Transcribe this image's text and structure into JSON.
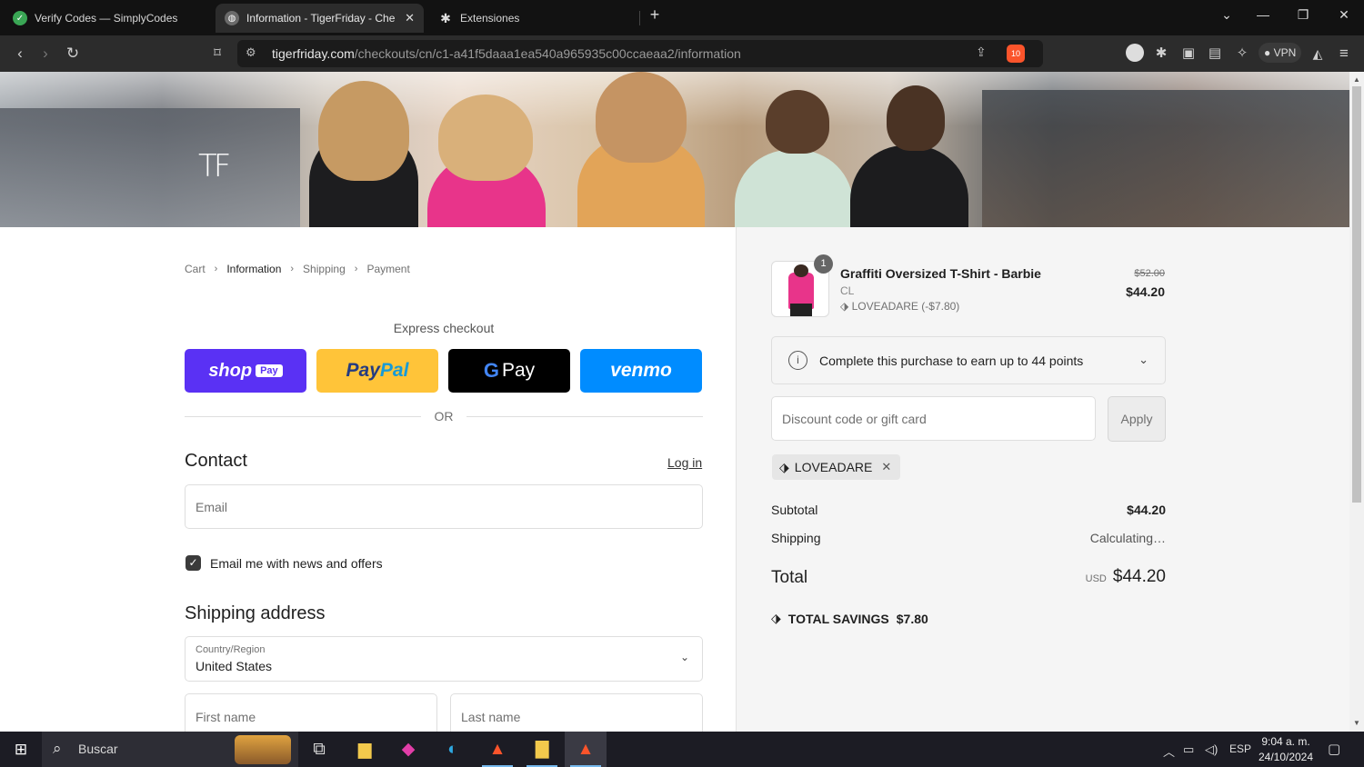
{
  "browser": {
    "tabs": [
      {
        "title": "Verify Codes — SimplyCodes",
        "icon": "simplycodes-icon"
      },
      {
        "title": "Information - TigerFriday - Che",
        "icon": "globe-icon"
      },
      {
        "title": "Extensiones",
        "icon": "puzzle-icon"
      }
    ],
    "url_host": "tigerfriday.com",
    "url_path": "/checkouts/cn/c1-a41f5daaa1ea540a965935c00ccaeaa2/information",
    "brave_badge": "10",
    "vpn_label": "VPN"
  },
  "store": {
    "logo_text": "TF"
  },
  "checkout": {
    "breadcrumb": [
      "Cart",
      "Information",
      "Shipping",
      "Payment"
    ],
    "express_title": "Express checkout",
    "express_buttons": {
      "shop": "shop",
      "shop_pay": "Pay",
      "paypal_a": "Pay",
      "paypal_b": "Pal",
      "gpay": "Pay",
      "venmo": "venmo"
    },
    "or_label": "OR",
    "contact_title": "Contact",
    "login_label": "Log in",
    "email_placeholder": "Email",
    "news_label": "Email me with news and offers",
    "shipping_title": "Shipping address",
    "country_label": "Country/Region",
    "country_value": "United States",
    "first_name_placeholder": "First name",
    "last_name_placeholder": "Last name"
  },
  "summary": {
    "quantity": "1",
    "product_name": "Graffiti Oversized T-Shirt - Barbie",
    "variant": "CL",
    "product_discount": "LOVEADARE (-$7.80)",
    "price_old": "$52.00",
    "price_new": "$44.20",
    "points_text": "Complete this purchase to earn up to 44 points",
    "discount_placeholder": "Discount code or gift card",
    "apply_label": "Apply",
    "applied_code": "LOVEADARE",
    "subtotal_label": "Subtotal",
    "subtotal_value": "$44.20",
    "shipping_label": "Shipping",
    "shipping_value": "Calculating…",
    "total_label": "Total",
    "currency": "USD",
    "total_value": "$44.20",
    "savings_label": "TOTAL SAVINGS",
    "savings_value": "$7.80"
  },
  "taskbar": {
    "search_label": "Buscar",
    "language": "ESP",
    "time": "9:04 a. m.",
    "date": "24/10/2024"
  },
  "colors": {
    "shop_pay": "#5a31f4",
    "paypal": "#ffc439",
    "gpay": "#000000",
    "venmo": "#008cff"
  }
}
